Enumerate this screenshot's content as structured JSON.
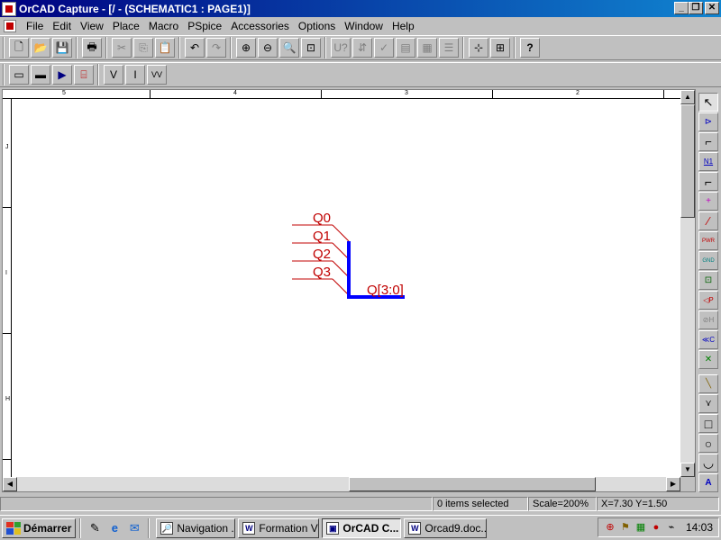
{
  "window": {
    "title": "OrCAD Capture - [/ - (SCHEMATIC1 : PAGE1)]",
    "minimize": "_",
    "restore": "❐",
    "close": "✕"
  },
  "menu": {
    "items": [
      "File",
      "Edit",
      "View",
      "Place",
      "Macro",
      "PSpice",
      "Accessories",
      "Options",
      "Window",
      "Help"
    ]
  },
  "toolbar1": {
    "buttons": [
      {
        "name": "new-icon",
        "glyph": "🗋"
      },
      {
        "name": "open-icon",
        "glyph": "📂"
      },
      {
        "name": "save-icon",
        "glyph": "💾"
      },
      {
        "name": "print-icon",
        "glyph": "🖶"
      },
      {
        "name": "cut-icon",
        "glyph": "✂"
      },
      {
        "name": "copy-icon",
        "glyph": "⎘"
      },
      {
        "name": "paste-icon",
        "glyph": "📋"
      },
      {
        "name": "undo-icon",
        "glyph": "↶"
      },
      {
        "name": "redo-icon",
        "glyph": "↷"
      },
      {
        "name": "zoom-in-icon",
        "glyph": "⊕"
      },
      {
        "name": "zoom-out-icon",
        "glyph": "⊖"
      },
      {
        "name": "zoom-area-icon",
        "glyph": "🔍"
      },
      {
        "name": "zoom-all-icon",
        "glyph": "⊡"
      },
      {
        "name": "annotate-icon",
        "glyph": "U?"
      },
      {
        "name": "back-annotate-icon",
        "glyph": "⇵"
      },
      {
        "name": "drc-icon",
        "glyph": "✓"
      },
      {
        "name": "netlist-icon",
        "glyph": "▤"
      },
      {
        "name": "cross-reference-icon",
        "glyph": "▦"
      },
      {
        "name": "bill-of-materials-icon",
        "glyph": "☰"
      },
      {
        "name": "snap-to-grid-icon",
        "glyph": "⊹"
      },
      {
        "name": "project-manager-icon",
        "glyph": "⊞"
      },
      {
        "name": "help-icon",
        "glyph": "?"
      }
    ]
  },
  "toolbar2": {
    "buttons": [
      {
        "name": "new-simulation-profile-icon",
        "glyph": "▭"
      },
      {
        "name": "edit-simulation-settings-icon",
        "glyph": "▬"
      },
      {
        "name": "run-pspice-icon",
        "glyph": "▶"
      },
      {
        "name": "view-simulation-results-icon",
        "glyph": "⌸"
      },
      {
        "name": "voltage-marker-icon",
        "glyph": "V"
      },
      {
        "name": "current-marker-icon",
        "glyph": "I"
      },
      {
        "name": "voltage-differential-marker-icon",
        "glyph": "VV"
      }
    ]
  },
  "rulers": {
    "top": [
      "5",
      "4",
      "3",
      "2"
    ],
    "left": [
      "J",
      "I",
      "H"
    ]
  },
  "schematic": {
    "color_wire": "#c00000",
    "color_bus": "#0000ff",
    "net_labels": [
      "Q0",
      "Q1",
      "Q2",
      "Q3"
    ],
    "bus_label": "Q[3:0]"
  },
  "palette": {
    "tools": [
      {
        "name": "select-tool-icon",
        "glyph": "↖"
      },
      {
        "name": "place-part-icon",
        "glyph": "⊳"
      },
      {
        "name": "place-wire-icon",
        "glyph": "⌐"
      },
      {
        "name": "place-net-alias-icon",
        "glyph": "N1"
      },
      {
        "name": "place-bus-icon",
        "glyph": "⌐"
      },
      {
        "name": "place-junction-icon",
        "glyph": "+"
      },
      {
        "name": "place-bus-entry-icon",
        "glyph": "∕"
      },
      {
        "name": "place-power-icon",
        "glyph": "PWR"
      },
      {
        "name": "place-ground-icon",
        "glyph": "GND"
      },
      {
        "name": "place-hierarchical-block-icon",
        "glyph": "⊡"
      },
      {
        "name": "place-hierarchical-port-icon",
        "glyph": "◁P"
      },
      {
        "name": "place-hierarchical-pin-icon",
        "glyph": "⊘H"
      },
      {
        "name": "place-off-page-connector-icon",
        "glyph": "≪C"
      },
      {
        "name": "place-no-connect-icon",
        "glyph": "✕"
      },
      {
        "name": "place-line-icon",
        "glyph": "╲"
      },
      {
        "name": "place-polyline-icon",
        "glyph": "⋎"
      },
      {
        "name": "place-rectangle-icon",
        "glyph": "□"
      },
      {
        "name": "place-ellipse-icon",
        "glyph": "○"
      },
      {
        "name": "place-arc-icon",
        "glyph": "◡"
      },
      {
        "name": "place-text-icon",
        "glyph": "A"
      }
    ]
  },
  "status": {
    "selection": "0 items selected",
    "scale": "Scale=200%",
    "coords": "X=7.30  Y=1.50"
  },
  "taskbar": {
    "start": "Démarrer",
    "tasks": [
      {
        "label": "Navigation ...",
        "glyph": "🔎",
        "active": false
      },
      {
        "label": "Formation Vi...",
        "glyph": "W",
        "active": false
      },
      {
        "label": "OrCAD C...",
        "glyph": "▣",
        "active": true
      },
      {
        "label": "Orcad9.doc...",
        "glyph": "W",
        "active": false
      }
    ],
    "clock": "14:03"
  }
}
